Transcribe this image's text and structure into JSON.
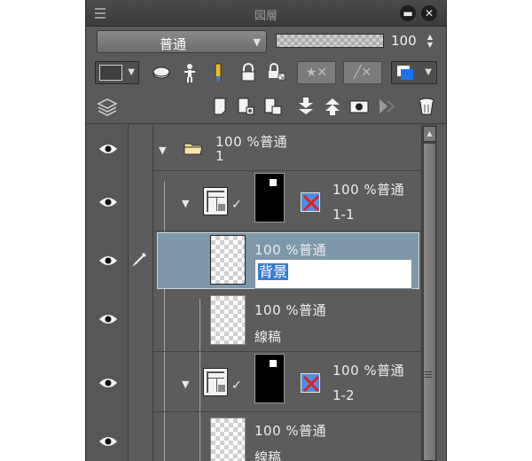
{
  "panel": {
    "title": "図層",
    "icons": {
      "grip": "panel-menu-grip-icon",
      "minimize": "minimize-icon",
      "close": "close-icon"
    },
    "minimize_label": "▬",
    "close_label": "✕"
  },
  "blend_row": {
    "blend_mode": "普通",
    "opacity_value": "100",
    "opacity_percent": 100
  },
  "toolbar": {
    "icons": [
      "color-swatch-icon",
      "disc-icon",
      "figure-icon",
      "pencil-icon",
      "lock-icon",
      "lock-alpha-icon",
      "reference-icon",
      "mask-toggle-icon",
      "layer-color-icon"
    ],
    "row2_icons": [
      "layers-stack-icon",
      "new-raster-layer-icon",
      "new-vector-layer-icon",
      "new-folder-icon",
      "merge-down-icon",
      "merge-up-icon",
      "layer-mask-icon",
      "clipping-icon",
      "trash-icon"
    ]
  },
  "layers": [
    {
      "opacity_blend": "100 %普通",
      "name": "1",
      "type": "folder"
    },
    {
      "opacity_blend": "100 %普通",
      "name": "1-1",
      "type": "frame-folder"
    },
    {
      "opacity_blend": "100 %普通",
      "name": "背景",
      "type": "raster",
      "selected": true,
      "editing": true
    },
    {
      "opacity_blend": "100 %普通",
      "name": "線稿",
      "type": "raster"
    },
    {
      "opacity_blend": "100 %普通",
      "name": "1-2",
      "type": "frame-folder"
    },
    {
      "opacity_blend": "100 %普通",
      "name": "線稿",
      "type": "raster"
    }
  ],
  "colors": {
    "panel_bg": "#5a5a5a",
    "selected_row": "#7e98aa",
    "text_highlight": "#3a7bd5",
    "layer_color_blue": "#1a73e8",
    "nomask_red": "#e02020"
  }
}
